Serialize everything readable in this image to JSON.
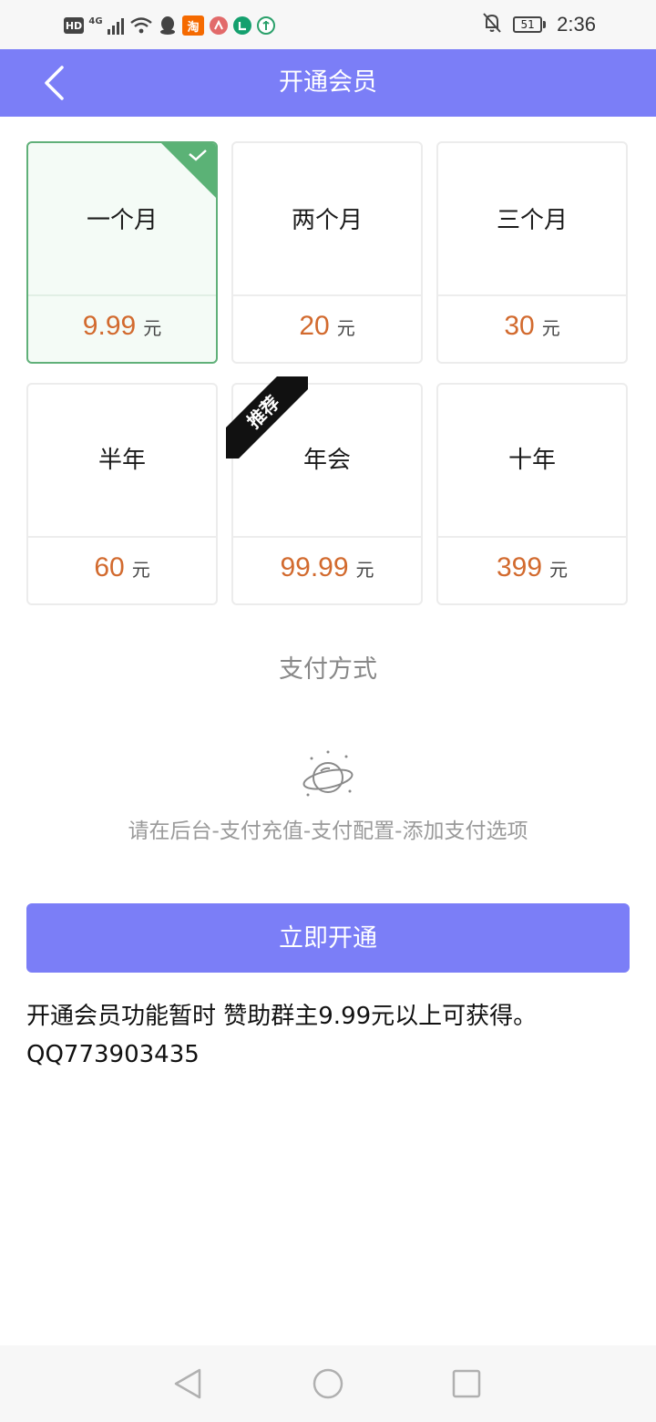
{
  "status_bar": {
    "network_type": "4G",
    "battery_level": "51",
    "time": "2:36",
    "icons": [
      "hd-icon",
      "signal-icon",
      "wifi-icon",
      "qq-icon",
      "taobao-icon",
      "app-icon-red",
      "app-icon-green",
      "app-icon-green-2",
      "mute-icon",
      "battery-icon"
    ],
    "hd_label": "HD",
    "taobao_label": "淘"
  },
  "header": {
    "title": "开通会员",
    "background": "#7b7ef7"
  },
  "plans": [
    {
      "name": "一个月",
      "price": "9.99",
      "unit": "元",
      "selected": true
    },
    {
      "name": "两个月",
      "price": "20",
      "unit": "元",
      "selected": false
    },
    {
      "name": "三个月",
      "price": "30",
      "unit": "元",
      "selected": false
    },
    {
      "name": "半年",
      "price": "60",
      "unit": "元",
      "selected": false
    },
    {
      "name": "年会",
      "price": "99.99",
      "unit": "元",
      "selected": false,
      "badge": "推荐"
    },
    {
      "name": "十年",
      "price": "399",
      "unit": "元",
      "selected": false
    }
  ],
  "colors": {
    "accent": "#7b7ef7",
    "price": "#d26a2e",
    "selected_border": "#60b079"
  },
  "payment": {
    "title": "支付方式",
    "hint": "请在后台-支付充值-支付配置-添加支付选项"
  },
  "actions": {
    "open_button": "立即开通"
  },
  "note": {
    "line1": "开通会员功能暂时 赞助群主9.99元以上可获得。",
    "line2": "QQ773903435"
  }
}
